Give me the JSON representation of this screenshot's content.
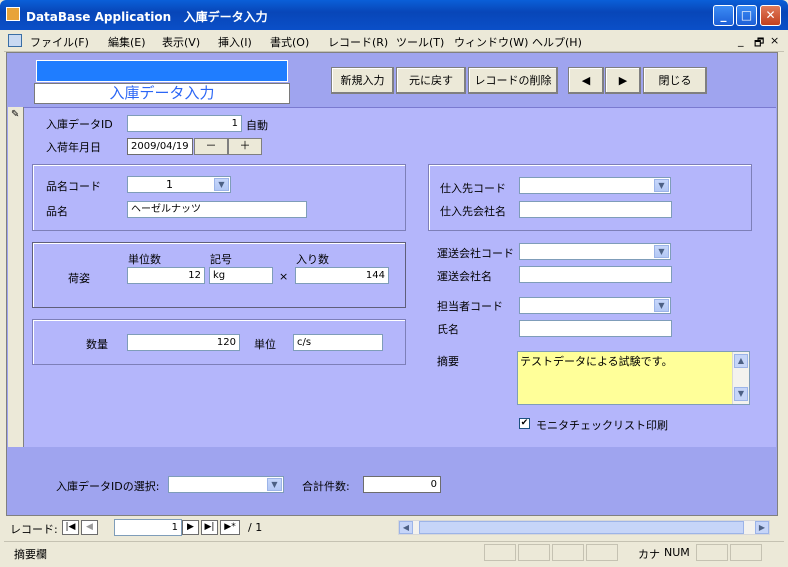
{
  "window": {
    "title": "DataBase Application   入庫データ入力",
    "min": "_",
    "max": "□",
    "close": "✕"
  },
  "menu": [
    "ファイル(F)",
    "編集(E)",
    "表示(V)",
    "挿入(I)",
    "書式(O)",
    "レコード(R)",
    "ツール(T)",
    "ウィンドウ(W)",
    "ヘルプ(H)"
  ],
  "menu_right": {
    "min": "_",
    "restore": "🗗",
    "close": "×"
  },
  "header": {
    "form_title": "入庫データ入力",
    "buttons": [
      "新規入力",
      "元に戻す",
      "レコードの削除",
      "◀",
      "▶",
      "閉じる"
    ]
  },
  "detail": {
    "record_icon": "✎",
    "id_label": "入庫データID",
    "id_value": "1",
    "id_auto": "自動",
    "date_label": "入荷年月日",
    "date_value": "2009/04/19",
    "date_minus": "－",
    "date_plus": "＋",
    "product_code_label": "品名コード",
    "product_code_value": "1",
    "product_name_label": "品名",
    "product_name_value": "ヘーゼルナッツ",
    "pack_label": "荷姿",
    "unit_count_label": "単位数",
    "unit_count_value": "12",
    "symbol_label": "記号",
    "symbol_value": "kg",
    "times": "×",
    "quantity_in_label": "入り数",
    "quantity_in_value": "144",
    "qty_label": "数量",
    "qty_value": "120",
    "unit_label": "単位",
    "unit_value": "c/s",
    "supplier_code_label": "仕入先コード",
    "supplier_name_label": "仕入先会社名",
    "carrier_code_label": "運送会社コード",
    "carrier_name_label": "運送会社名",
    "staff_code_label": "担当者コード",
    "staff_name_label": "氏名",
    "memo_label": "摘要",
    "memo_value": "テストデータによる試験です。",
    "monitor_check_label": "モニタチェックリスト印刷",
    "monitor_checked": "✔"
  },
  "footer": {
    "select_label": "入庫データIDの選択:",
    "total_label": "合計件数:",
    "total_value": "0"
  },
  "nav": {
    "label": "レコード:",
    "current": "1",
    "total": "/ 1",
    "first": "|◀",
    "prev": "◀",
    "next": "▶",
    "last": "▶|",
    "new": "▶*"
  },
  "status": {
    "text": "摘要欄",
    "kana": "カナ",
    "num": "NUM"
  }
}
